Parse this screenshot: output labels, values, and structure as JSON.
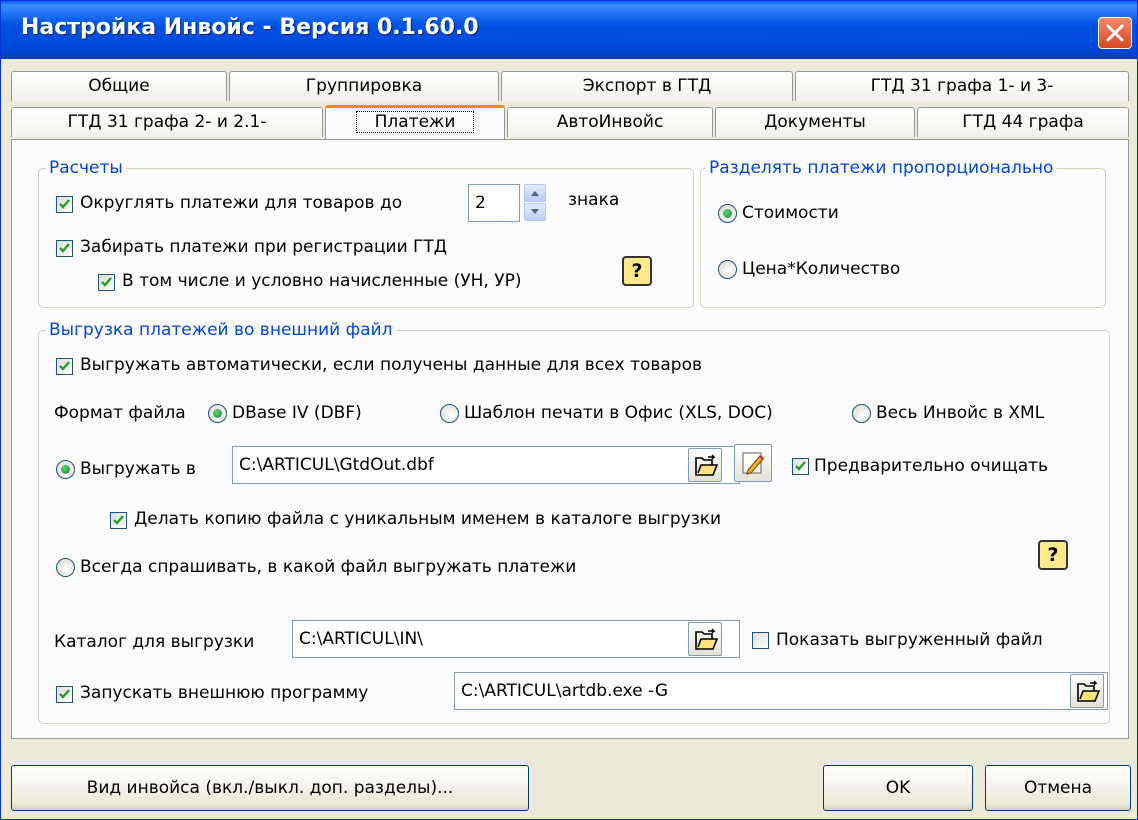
{
  "window": {
    "title": "Настройка Инвойс - Версия 0.1.60.0"
  },
  "tabs_row1": [
    "Общие",
    "Группировка",
    "Экспорт в ГТД",
    "ГТД 31 графа 1- и 3-"
  ],
  "tabs_row2": [
    "ГТД 31 графа 2- и 2.1-",
    "Платежи",
    "АвтоИнвойс",
    "Документы",
    "ГТД 44 графа"
  ],
  "active_tab": "Платежи",
  "calc": {
    "title": "Расчеты",
    "round_label": "Округлять платежи для товаров до",
    "round_checked": true,
    "round_digits": "2",
    "round_suffix": "знака",
    "take_label": "Забирать платежи при регистрации ГТД",
    "take_checked": true,
    "conditional_label": "В том числе и условно начисленные (УН, УР)",
    "conditional_checked": true
  },
  "split": {
    "title": "Разделять платежи пропорционально",
    "options": [
      "Стоимости",
      "Цена*Количество"
    ],
    "selected": "Стоимости"
  },
  "export": {
    "title": "Выгрузка платежей во внешний файл",
    "auto_label": "Выгружать автоматически, если получены данные для всех товаров",
    "auto_checked": true,
    "format_label": "Формат файла",
    "formats": [
      "DBase IV (DBF)",
      "Шаблон печати в Офис (XLS, DOC)",
      "Весь Инвойс в XML"
    ],
    "format_selected": "DBase IV (DBF)",
    "export_to_label": "Выгружать в",
    "export_to_path": "C:\\ARTICUL\\GtdOut.dbf",
    "preclear_label": "Предварительно очищать",
    "preclear_checked": true,
    "copy_label": "Делать копию файла с уникальным именем в каталоге выгрузки",
    "copy_checked": true,
    "always_ask_label": "Всегда спрашивать, в какой файл выгружать платежи",
    "dir_label": "Каталог для выгрузки",
    "dir_path": "C:\\ARTICUL\\IN\\",
    "show_file_label": "Показать выгруженный файл",
    "show_file_checked": false,
    "run_label": "Запускать внешнюю программу",
    "run_checked": true,
    "run_path": "C:\\ARTICUL\\artdb.exe -G"
  },
  "footer": {
    "view_button": "Вид инвойса (вкл./выкл. доп. разделы)...",
    "ok_button": "OK",
    "cancel_button": "Отмена"
  },
  "icons": {
    "close": "close-icon",
    "help": "help-icon",
    "folder": "folder-open-icon",
    "edit": "edit-icon",
    "checkmark": "checkmark-icon"
  },
  "colors": {
    "title_bar": "#0054e3",
    "group_label": "#0046d5",
    "active_tab_accent": "#e68b2c",
    "dialog_bg": "#ece9d8"
  },
  "help_glyph": "?"
}
